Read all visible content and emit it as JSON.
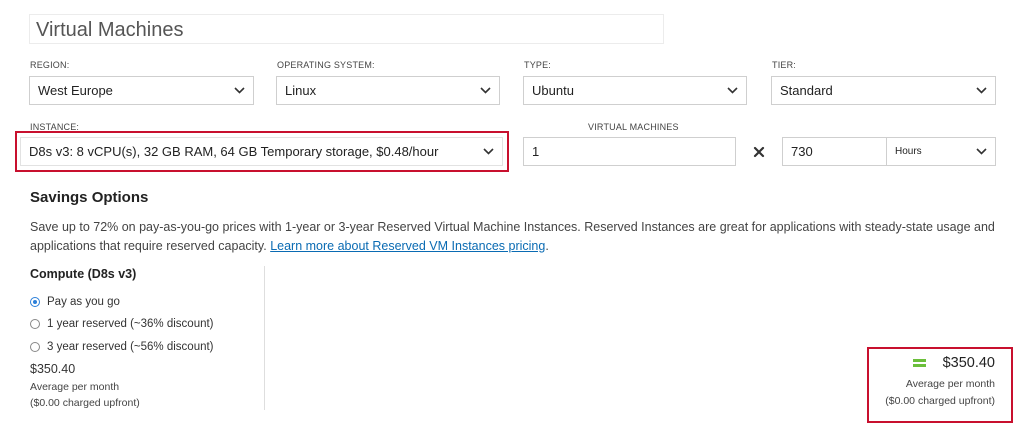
{
  "page_title": "Virtual Machines",
  "fields": {
    "region": {
      "label": "REGION:",
      "value": "West Europe"
    },
    "os": {
      "label": "OPERATING SYSTEM:",
      "value": "Linux"
    },
    "type": {
      "label": "TYPE:",
      "value": "Ubuntu"
    },
    "tier": {
      "label": "TIER:",
      "value": "Standard"
    },
    "instance": {
      "label": "INSTANCE:",
      "value": "D8s v3: 8 vCPU(s), 32 GB RAM, 64 GB Temporary storage, $0.48/hour"
    },
    "vm_count": {
      "label": "VIRTUAL MACHINES",
      "value": "1"
    },
    "hours": {
      "value": "730"
    },
    "hours_unit": {
      "value": "Hours"
    }
  },
  "savings": {
    "title": "Savings Options",
    "description": "Save up to 72% on pay-as-you-go prices with 1-year or 3-year Reserved Virtual Machine Instances. Reserved Instances are great for applications with steady-state usage and applications that require reserved capacity.",
    "link_text": "Learn more about Reserved VM Instances pricing",
    "link_suffix": ".",
    "compute_title": "Compute (D8s v3)",
    "options": [
      {
        "label": "Pay as you go",
        "checked": true
      },
      {
        "label": "1 year reserved (~36% discount)",
        "checked": false
      },
      {
        "label": "3 year reserved (~56% discount)",
        "checked": false
      }
    ],
    "price": "$350.40",
    "price_note": "Average per month",
    "upfront_note": "($0.00 charged upfront)"
  },
  "total": {
    "amount": "$350.40",
    "note": "Average per month",
    "upfront": "($0.00 charged upfront)"
  },
  "colors": {
    "highlight": "#c8102e",
    "link": "#0a6bb3",
    "radio_selected": "#2b7fd9",
    "equals": "#6bbf3b"
  },
  "icons": {
    "dropdown": "chevron-down-icon",
    "multiply": "times-icon",
    "equals": "equals-icon"
  }
}
